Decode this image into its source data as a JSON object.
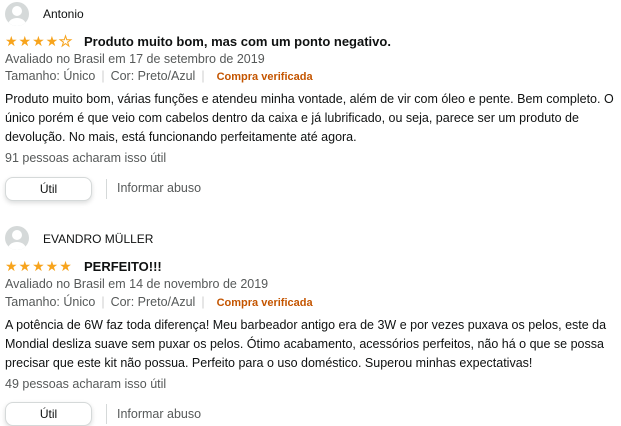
{
  "reviews": [
    {
      "name": "Antonio",
      "rating": 4,
      "max_rating": 5,
      "title": "Produto muito bom, mas com um ponto negativo.",
      "date_line": "Avaliado no Brasil em 17 de setembro de 2019",
      "size": "Tamanho: Único",
      "color": "Cor: Preto/Azul",
      "verified": "Compra verificada",
      "body": "Produto muito bom, várias funções e atendeu minha vontade, além de vir com óleo e pente. Bem completo. O único porém é que veio com cabelos dentro da caixa e já lubrificado, ou seja, parece ser um produto de devolução. No mais, está funcionando perfeitamente até agora.",
      "helpful": "91 pessoas acharam isso útil",
      "useful_label": "Útil",
      "report_label": "Informar abuso"
    },
    {
      "name": "EVANDRO MÜLLER",
      "rating": 5,
      "max_rating": 5,
      "title": "PERFEITO!!!",
      "date_line": "Avaliado no Brasil em 14 de novembro de 2019",
      "size": "Tamanho: Único",
      "color": "Cor: Preto/Azul",
      "verified": "Compra verificada",
      "body": "A potência de 6W faz toda diferença! Meu barbeador antigo era de 3W e por vezes puxava os pelos, este da Mondial desliza suave sem puxar os pelos. Ótimo acabamento, acessórios perfeitos, não há o que se possa precisar que este kit não possua. Perfeito para o uso doméstico. Superou minhas expectativas!",
      "helpful": "49 pessoas acharam isso útil",
      "useful_label": "Útil",
      "report_label": "Informar abuso"
    }
  ],
  "colors": {
    "star": "#f7a41d",
    "verified": "#c45500",
    "muted": "#565959"
  }
}
